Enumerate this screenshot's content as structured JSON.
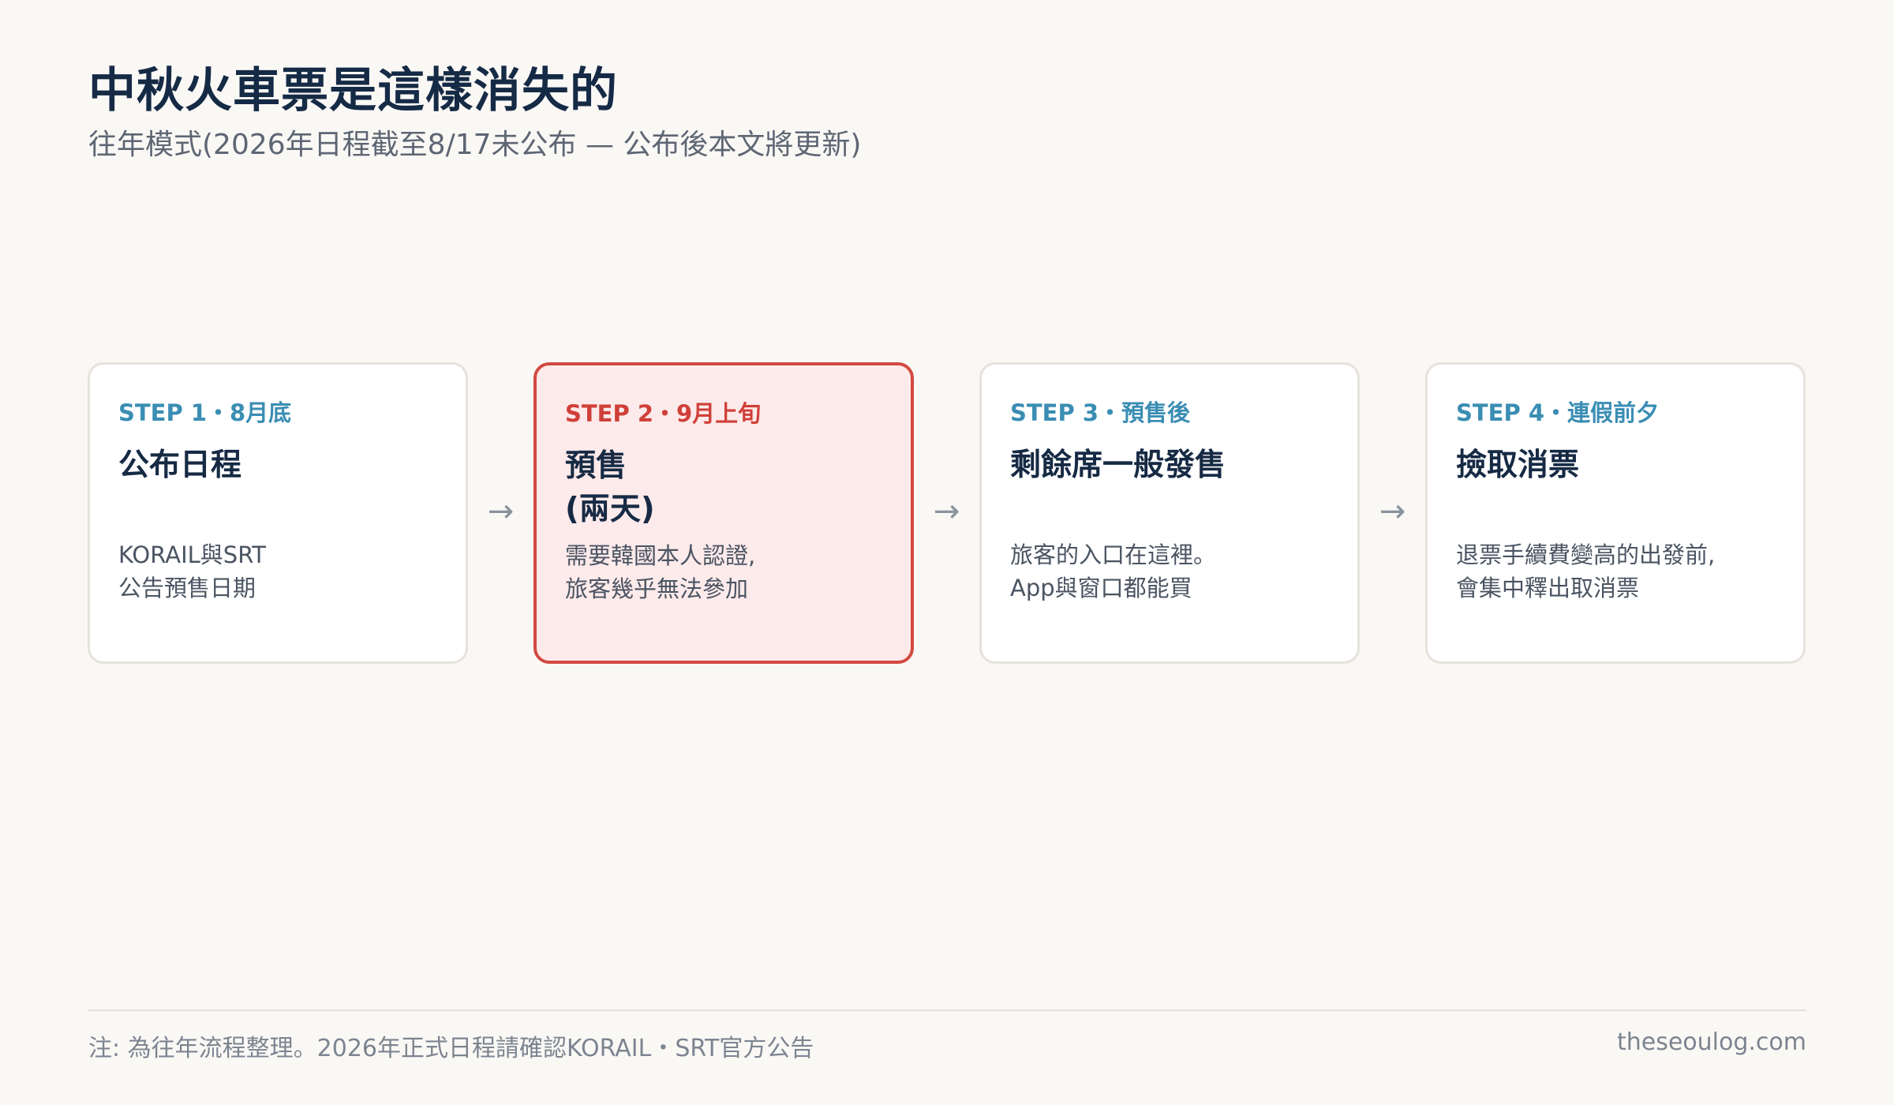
{
  "header": {
    "title": "中秋火車票是這樣消失的",
    "subtitle": "往年模式(2026年日程截至8/17未公布 — 公布後本文將更新)"
  },
  "colors": {
    "accent_blue": "#3a8db3",
    "accent_red": "#cf4038",
    "highlight_bg": "#fdeaea",
    "title_navy": "#152a45"
  },
  "steps": [
    {
      "label": "STEP 1・8月底",
      "title": "公布日程",
      "desc": "KORAIL與SRT\n公告預售日期"
    },
    {
      "label": "STEP 2・9月上旬",
      "title": "預售\n(兩天)",
      "desc": "需要韓國本人認證,\n旅客幾乎無法參加"
    },
    {
      "label": "STEP 3・預售後",
      "title": "剩餘席一般發售",
      "desc": "旅客的入口在這裡。\nApp與窗口都能買"
    },
    {
      "label": "STEP 4・連假前夕",
      "title": "撿取消票",
      "desc": "退票手續費變高的出發前,\n會集中釋出取消票"
    }
  ],
  "arrows": {
    "glyph": "→"
  },
  "footer": {
    "note": "注: 為往年流程整理。2026年正式日程請確認KORAIL・SRT官方公告",
    "site": "theseoulog.com"
  }
}
